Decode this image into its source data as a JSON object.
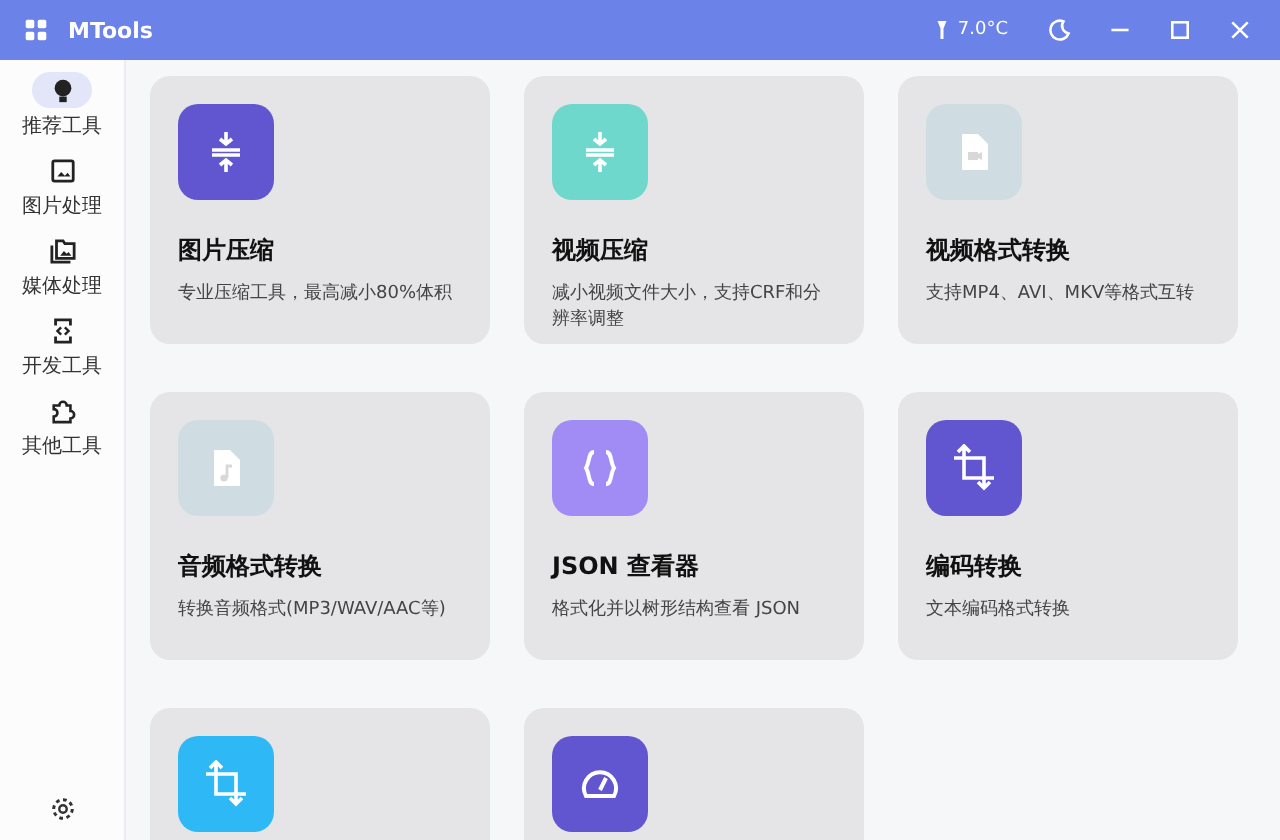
{
  "window": {
    "title": "MTools",
    "temperature": "7.0°C"
  },
  "sidebar": {
    "items": [
      {
        "label": "推荐工具",
        "kind": "bulb",
        "selected": true
      },
      {
        "label": "图片处理",
        "kind": "image",
        "selected": false
      },
      {
        "label": "媒体处理",
        "kind": "images",
        "selected": false
      },
      {
        "label": "开发工具",
        "kind": "code",
        "selected": false
      },
      {
        "label": "其他工具",
        "kind": "puzzle",
        "selected": false
      }
    ]
  },
  "cards": [
    {
      "title": "图片压缩",
      "description": "专业压缩工具，最高减小80%体积",
      "kind": "compress",
      "color": "#6256d0"
    },
    {
      "title": "视频压缩",
      "description": "减小视频文件大小，支持CRF和分辨率调整",
      "kind": "compress",
      "color": "#6fd8cc"
    },
    {
      "title": "视频格式转换",
      "description": "支持MP4、AVI、MKV等格式互转",
      "kind": "file-video",
      "color": "#cfdde2"
    },
    {
      "title": "音频格式转换",
      "description": "转换音频格式(MP3/WAV/AAC等)",
      "kind": "file-audio",
      "color": "#cfdde2"
    },
    {
      "title": "JSON 查看器",
      "description": "格式化并以树形结构查看 JSON",
      "kind": "braces",
      "color": "#a08cf4"
    },
    {
      "title": "编码转换",
      "description": "文本编码格式转换",
      "kind": "crop",
      "color": "#6256d0"
    },
    {
      "kind": "crop",
      "color": "#2eb8f6"
    },
    {
      "kind": "gauge",
      "color": "#6256d0"
    }
  ]
}
